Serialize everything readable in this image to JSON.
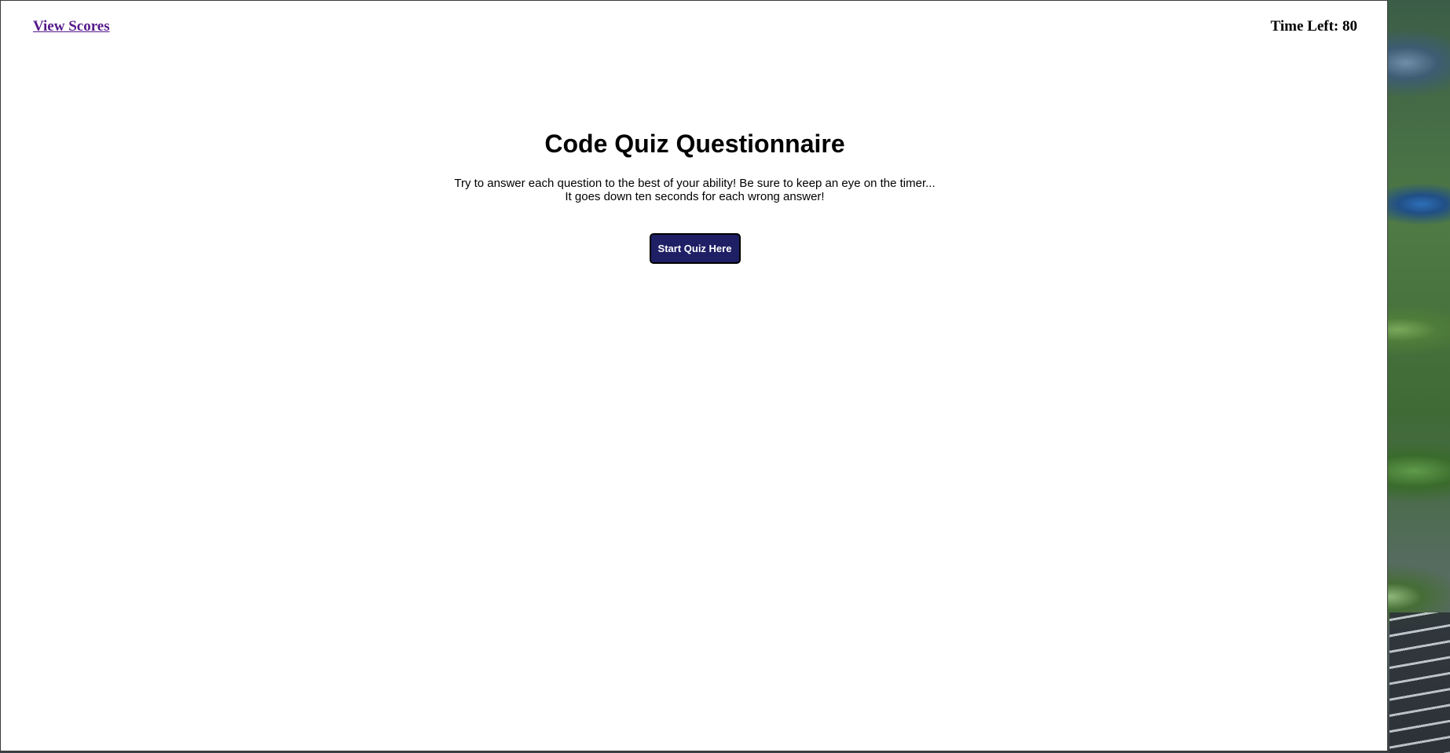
{
  "header": {
    "view_scores_label": "View Scores",
    "timer_text": "Time Left: 80"
  },
  "main": {
    "title": "Code Quiz Questionnaire",
    "description_line1": "Try to answer each question to the best of your ability! Be sure to keep an eye on the timer...",
    "description_line2": "It goes down ten seconds for each wrong answer!",
    "start_button_label": "Start Quiz Here"
  },
  "colors": {
    "link": "#551a8b",
    "button_bg": "#1f1f66",
    "button_text": "#ffffff"
  }
}
